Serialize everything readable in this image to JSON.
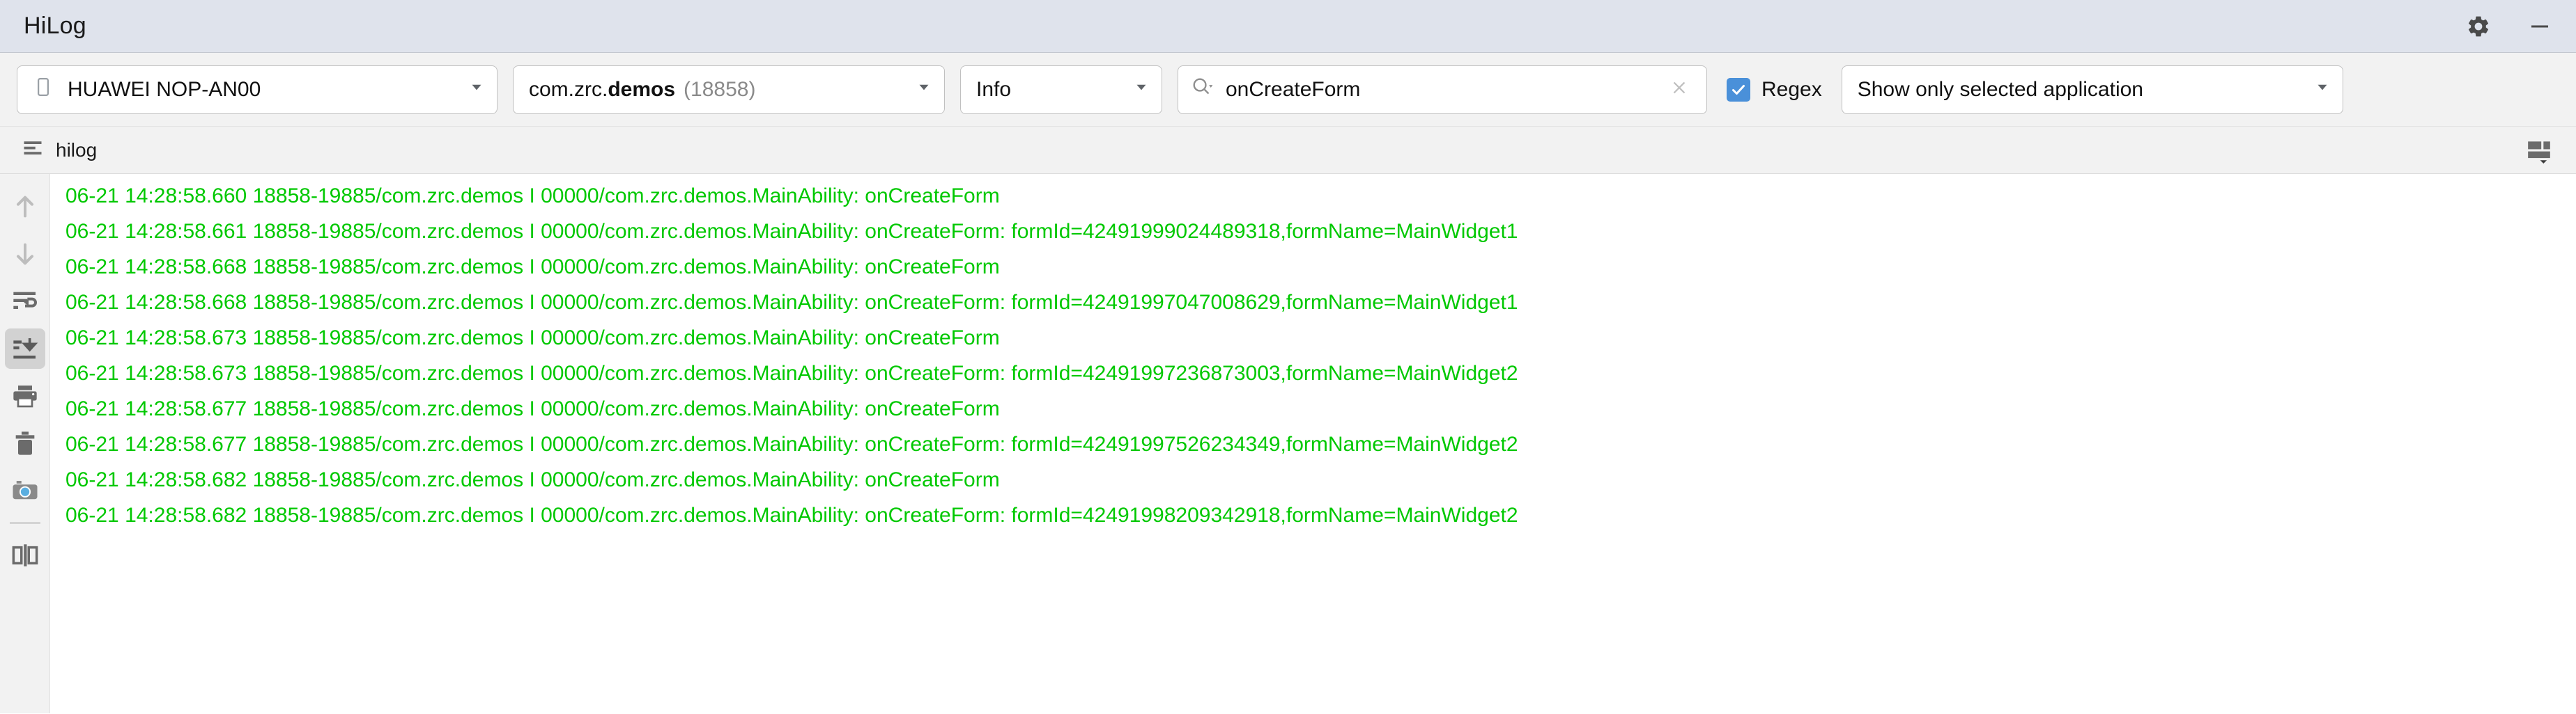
{
  "window": {
    "title": "HiLog",
    "settings_icon": "gear-icon",
    "minimize_icon": "minimize-icon"
  },
  "toolbar": {
    "device": {
      "icon": "phone-icon",
      "value": "HUAWEI NOP-AN00",
      "caret_icon": "chevron-down-icon"
    },
    "process": {
      "prefix": "com.zrc.",
      "bold": "demos",
      "pid": "(18858)",
      "caret_icon": "chevron-down-icon"
    },
    "level": {
      "value": "Info",
      "caret_icon": "chevron-down-icon"
    },
    "search": {
      "icon": "search-icon",
      "value": "onCreateForm",
      "placeholder": "Search",
      "clear_icon": "close-icon"
    },
    "regex": {
      "label": "Regex",
      "checked": true,
      "accent": "#4a90d9"
    },
    "scope": {
      "value": "Show only selected application",
      "caret_icon": "chevron-down-icon"
    }
  },
  "tabbar": {
    "tab_icon": "list-lines-icon",
    "tab_label": "hilog",
    "layout_icon": "panel-layout-icon"
  },
  "sidebar": {
    "items": [
      {
        "name": "scroll-up-icon",
        "label": "Up",
        "state": "disabled"
      },
      {
        "name": "scroll-down-icon",
        "label": "Down",
        "state": "disabled"
      },
      {
        "name": "soft-wrap-icon",
        "label": "Soft-Wrap",
        "state": "normal"
      },
      {
        "name": "scroll-to-end-icon",
        "label": "Scroll to End",
        "state": "active"
      },
      {
        "name": "print-icon",
        "label": "Print",
        "state": "normal"
      },
      {
        "name": "clear-icon",
        "label": "Clear",
        "state": "normal"
      },
      {
        "name": "screenshot-icon",
        "label": "Screenshot",
        "state": "normal"
      },
      {
        "name": "split-panel-icon",
        "label": "Split Panel",
        "state": "normal"
      }
    ]
  },
  "log": {
    "text_color": "#00c800",
    "lines": [
      "06-21 14:28:58.660 18858-19885/com.zrc.demos I 00000/com.zrc.demos.MainAbility: onCreateForm",
      "06-21 14:28:58.661 18858-19885/com.zrc.demos I 00000/com.zrc.demos.MainAbility: onCreateForm: formId=42491999024489318,formName=MainWidget1",
      "06-21 14:28:58.668 18858-19885/com.zrc.demos I 00000/com.zrc.demos.MainAbility: onCreateForm",
      "06-21 14:28:58.668 18858-19885/com.zrc.demos I 00000/com.zrc.demos.MainAbility: onCreateForm: formId=42491997047008629,formName=MainWidget1",
      "06-21 14:28:58.673 18858-19885/com.zrc.demos I 00000/com.zrc.demos.MainAbility: onCreateForm",
      "06-21 14:28:58.673 18858-19885/com.zrc.demos I 00000/com.zrc.demos.MainAbility: onCreateForm: formId=42491997236873003,formName=MainWidget2",
      "06-21 14:28:58.677 18858-19885/com.zrc.demos I 00000/com.zrc.demos.MainAbility: onCreateForm",
      "06-21 14:28:58.677 18858-19885/com.zrc.demos I 00000/com.zrc.demos.MainAbility: onCreateForm: formId=42491997526234349,formName=MainWidget2",
      "06-21 14:28:58.682 18858-19885/com.zrc.demos I 00000/com.zrc.demos.MainAbility: onCreateForm",
      "06-21 14:28:58.682 18858-19885/com.zrc.demos I 00000/com.zrc.demos.MainAbility: onCreateForm: formId=42491998209342918,formName=MainWidget2"
    ]
  }
}
